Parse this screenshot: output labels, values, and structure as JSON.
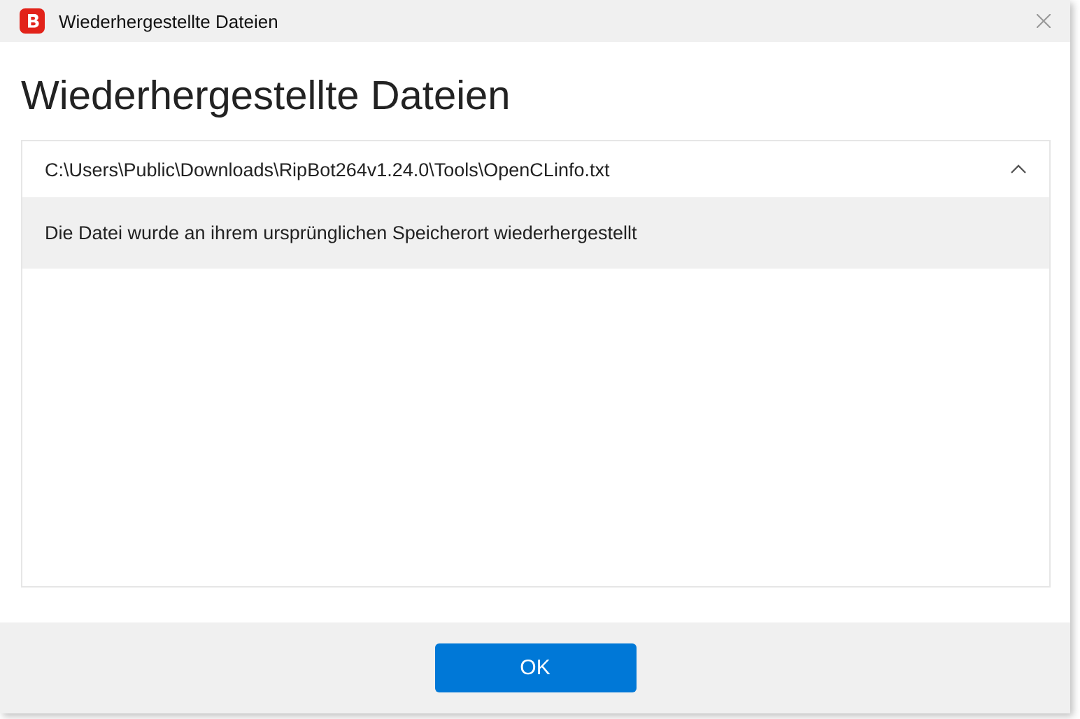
{
  "window": {
    "title": "Wiederhergestellte Dateien"
  },
  "heading": "Wiederhergestellte Dateien",
  "files": [
    {
      "path": "C:\\Users\\Public\\Downloads\\RipBot264v1.24.0\\Tools\\OpenCLinfo.txt",
      "expanded": true,
      "detail": "Die Datei wurde an ihrem ursprünglichen Speicherort wiederhergestellt"
    }
  ],
  "buttons": [
    "OK"
  ]
}
